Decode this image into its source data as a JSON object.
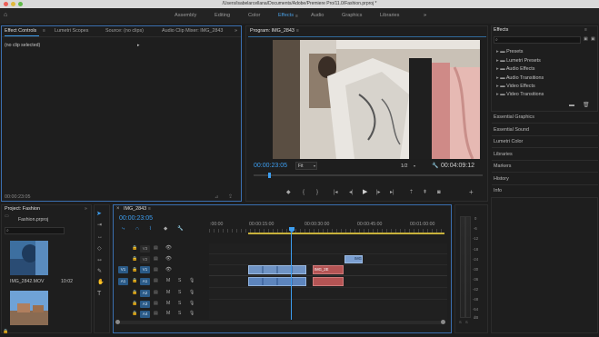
{
  "window": {
    "title": "/Users/isabelarcellana/Documents/Adobe/Premiere Pro/11.0/Fashion.prproj *"
  },
  "workspaces": {
    "items": [
      "Assembly",
      "Editing",
      "Color",
      "Effects",
      "Audio",
      "Graphics",
      "Libraries"
    ],
    "more": "»",
    "active": "Effects"
  },
  "source_panel": {
    "tabs": [
      "Effect Controls",
      "Lumetri Scopes",
      "Source: (no clips)",
      "Audio Clip Mixer: IMG_2843"
    ],
    "more": "»",
    "body_text": "(no clip selected)",
    "timecode": "00:00:23:05"
  },
  "program": {
    "title": "Program: IMG_2843",
    "timecode": "00:00:23:05",
    "fit": "Fit",
    "resolution": "1/2",
    "duration": "00:04:09:12"
  },
  "effects_panel": {
    "title": "Effects",
    "items": [
      "Presets",
      "Lumetri Presets",
      "Audio Effects",
      "Audio Transitions",
      "Video Effects",
      "Video Transitions"
    ],
    "sections": [
      "Essential Graphics",
      "Essential Sound",
      "Lumetri Color",
      "Libraries",
      "Markers",
      "History",
      "Info"
    ]
  },
  "project": {
    "title": "Project: Fashion",
    "file": "Fashion.prproj",
    "clips": [
      {
        "name": "IMG_2842.MOV",
        "duration": "10:02"
      }
    ]
  },
  "timeline": {
    "title": "IMG_2843",
    "timecode": "00:00:23:05",
    "ruler": [
      ":00:00",
      "00:00:15:00",
      "00:00:30:00",
      "00:00:45:00",
      "00:01:00:00"
    ],
    "video_tracks": [
      "V3",
      "V2",
      "V1"
    ],
    "audio_tracks": [
      "A1",
      "A2",
      "A3",
      "A4"
    ],
    "source_patch_video": "V1",
    "source_patch_audio": "A1",
    "clip_labels": {
      "v1_red": "IMG_2E",
      "v2": "IMG"
    },
    "track_flags": {
      "m": "M",
      "s": "S"
    }
  },
  "meters": {
    "labels": [
      "0",
      "-6",
      "-12",
      "-18",
      "-24",
      "-30",
      "-36",
      "-42",
      "-48",
      "-54",
      "dB"
    ]
  },
  "colors": {
    "accent": "#3d9ef0",
    "timecode": "#3d9ef0",
    "clip_video": "#6f93c4",
    "clip_red": "#b45454"
  }
}
